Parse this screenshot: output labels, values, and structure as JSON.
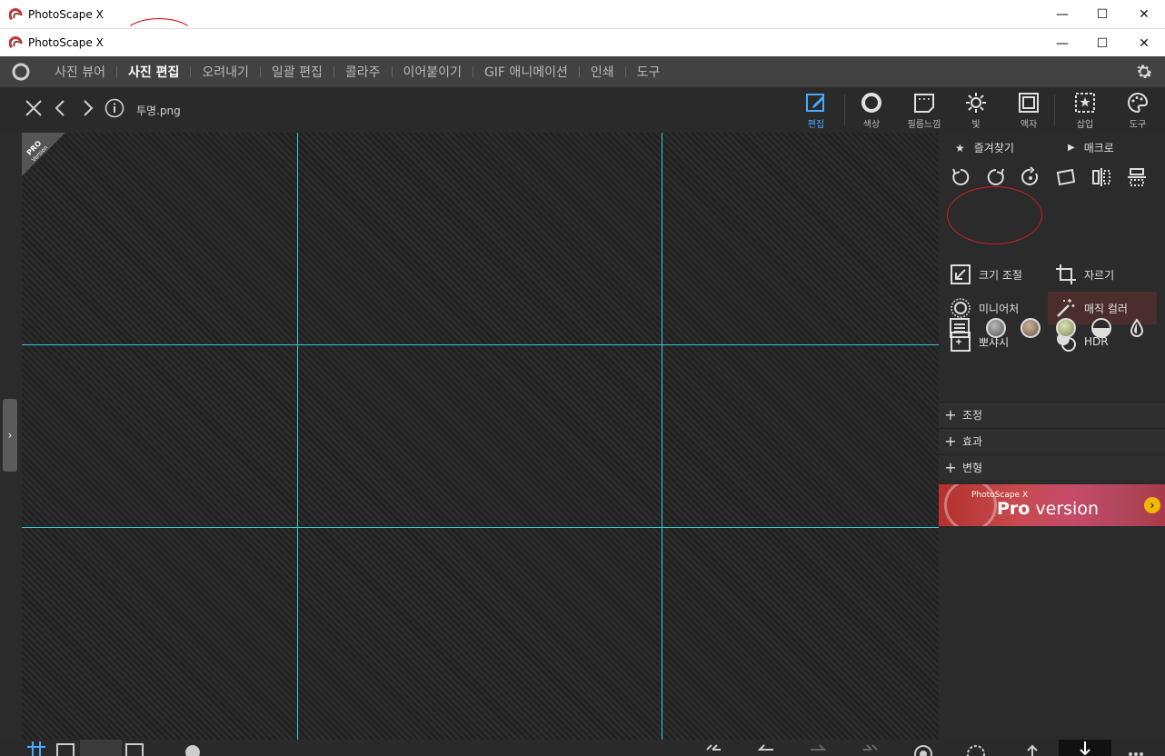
{
  "window": {
    "title_outer": "PhotoScape X",
    "title_inner": "PhotoScape X",
    "controls": {
      "minimize": "—",
      "maximize": "☐",
      "close": "✕"
    }
  },
  "menu": {
    "items": [
      {
        "label": "사진 뷰어",
        "active": false
      },
      {
        "label": "사진 편집",
        "active": true
      },
      {
        "label": "오려내기",
        "active": false
      },
      {
        "label": "일괄 편집",
        "active": false
      },
      {
        "label": "콜라주",
        "active": false
      },
      {
        "label": "이어붙이기",
        "active": false
      },
      {
        "label": "GIF 애니메이션",
        "active": false
      },
      {
        "label": "인쇄",
        "active": false
      },
      {
        "label": "도구",
        "active": false
      }
    ]
  },
  "toolbar": {
    "filename": "투명.png",
    "tools": [
      {
        "label": "편집",
        "icon": "edit-icon",
        "active": true
      },
      {
        "label": "색상",
        "icon": "color-circle-icon"
      },
      {
        "label": "필름느낌",
        "icon": "film-icon"
      },
      {
        "label": "빛",
        "icon": "sun-icon"
      },
      {
        "label": "액자",
        "icon": "frame-icon"
      },
      {
        "label": "삽입",
        "icon": "insert-icon"
      },
      {
        "label": "도구",
        "icon": "palette-icon"
      }
    ]
  },
  "canvas": {
    "pro_ribbon_top": "PRO",
    "pro_ribbon_bottom": "Version"
  },
  "panel": {
    "favorites": "즐겨찾기",
    "macro": "매크로",
    "items": {
      "resize": "크기 조절",
      "crop": "자르기",
      "miniature": "미니어처",
      "magic_color": "매직 컬러",
      "sparkle": "뽀샤시",
      "hdr": "HDR"
    },
    "sections": [
      "조정",
      "효과",
      "변형"
    ],
    "banner": {
      "small": "PhotoScape X",
      "big_bold": "Pro",
      "big_rest": " version"
    }
  },
  "colors": {
    "accent_blue": "#4aa8ff",
    "guide_cyan": "#38c9d6",
    "annotation_red": "#c82020"
  }
}
